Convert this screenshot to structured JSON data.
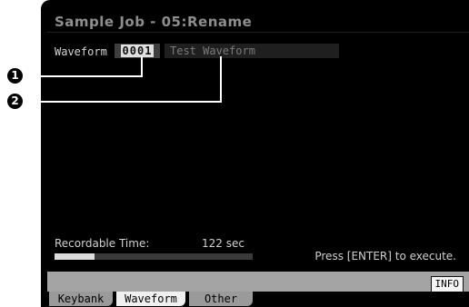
{
  "screen": {
    "title": "Sample Job - 05:Rename"
  },
  "waveform": {
    "label": "Waveform",
    "number": "0001",
    "name": "Test Waveform"
  },
  "recordable": {
    "label": "Recordable Time:",
    "value": "122 sec",
    "fill_fraction": 0.2
  },
  "prompt": "Press [ENTER] to execute.",
  "info_button": "INFO",
  "tabs": [
    {
      "label": "Keybank",
      "active": false
    },
    {
      "label": "Waveform",
      "active": true
    },
    {
      "label": "Other",
      "active": false
    }
  ],
  "callouts": [
    "1",
    "2"
  ]
}
